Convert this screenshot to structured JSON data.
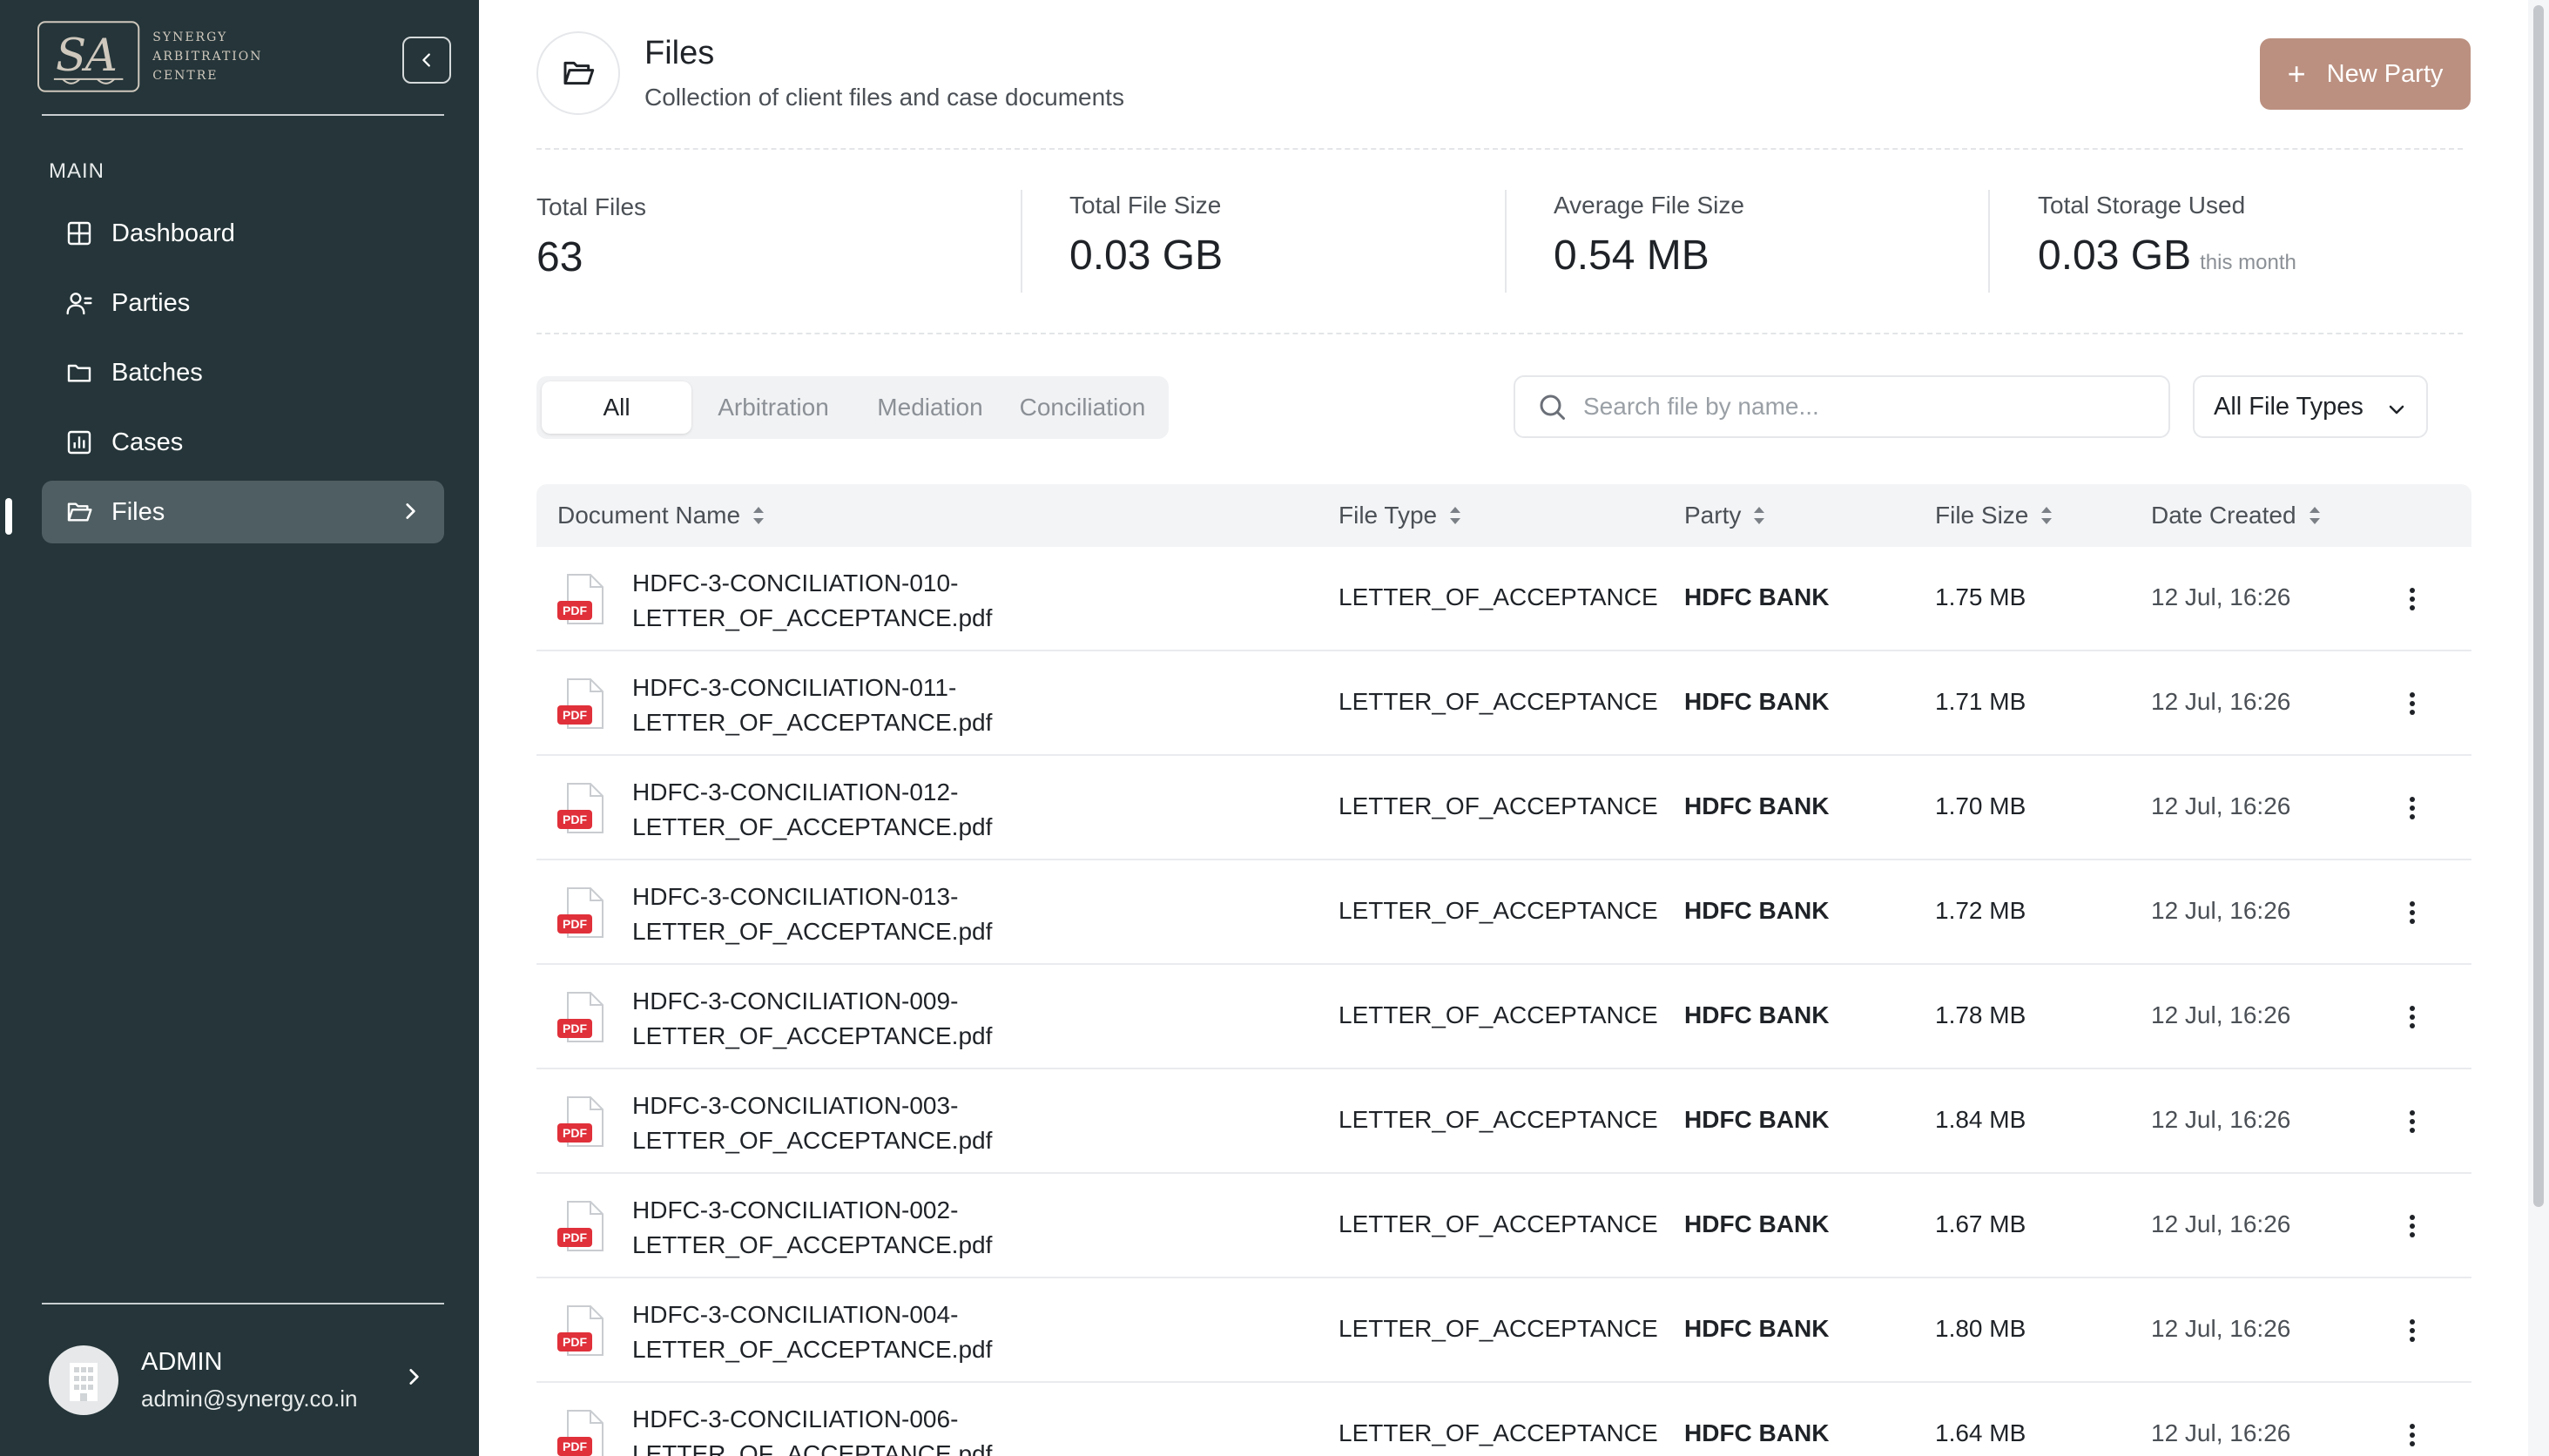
{
  "sidebar": {
    "brand": {
      "line1": "SYNERGY",
      "line2": "ARBITRATION CENTRE"
    },
    "section_label": "MAIN",
    "items": [
      {
        "label": "Dashboard",
        "icon": "grid-icon"
      },
      {
        "label": "Parties",
        "icon": "users-icon"
      },
      {
        "label": "Batches",
        "icon": "folder-icon"
      },
      {
        "label": "Cases",
        "icon": "chart-icon"
      },
      {
        "label": "Files",
        "icon": "folder-open-icon",
        "active": true
      }
    ],
    "user": {
      "name": "ADMIN",
      "email": "admin@synergy.co.in"
    }
  },
  "header": {
    "title": "Files",
    "subtitle": "Collection of client files and case documents",
    "new_button": "New Party"
  },
  "stats": [
    {
      "label": "Total Files",
      "value": "63",
      "suffix": ""
    },
    {
      "label": "Total File Size",
      "value": "0.03 GB",
      "suffix": ""
    },
    {
      "label": "Average File Size",
      "value": "0.54 MB",
      "suffix": ""
    },
    {
      "label": "Total Storage Used",
      "value": "0.03 GB",
      "suffix": "this month"
    }
  ],
  "tabs": [
    {
      "label": "All",
      "active": true
    },
    {
      "label": "Arbitration"
    },
    {
      "label": "Mediation"
    },
    {
      "label": "Conciliation"
    }
  ],
  "search": {
    "placeholder": "Search file by name..."
  },
  "filter": {
    "label": "All File Types"
  },
  "table": {
    "columns": [
      "Document Name",
      "File Type",
      "Party",
      "File Size",
      "Date Created"
    ],
    "rows": [
      {
        "name1": "HDFC-3-CONCILIATION-010-",
        "name2": "LETTER_OF_ACCEPTANCE.pdf",
        "type": "LETTER_OF_ACCEPTANCE",
        "party": "HDFC BANK",
        "size": "1.75 MB",
        "date": "12 Jul, 16:26"
      },
      {
        "name1": "HDFC-3-CONCILIATION-011-",
        "name2": "LETTER_OF_ACCEPTANCE.pdf",
        "type": "LETTER_OF_ACCEPTANCE",
        "party": "HDFC BANK",
        "size": "1.71 MB",
        "date": "12 Jul, 16:26"
      },
      {
        "name1": "HDFC-3-CONCILIATION-012-",
        "name2": "LETTER_OF_ACCEPTANCE.pdf",
        "type": "LETTER_OF_ACCEPTANCE",
        "party": "HDFC BANK",
        "size": "1.70 MB",
        "date": "12 Jul, 16:26"
      },
      {
        "name1": "HDFC-3-CONCILIATION-013-",
        "name2": "LETTER_OF_ACCEPTANCE.pdf",
        "type": "LETTER_OF_ACCEPTANCE",
        "party": "HDFC BANK",
        "size": "1.72 MB",
        "date": "12 Jul, 16:26"
      },
      {
        "name1": "HDFC-3-CONCILIATION-009-",
        "name2": "LETTER_OF_ACCEPTANCE.pdf",
        "type": "LETTER_OF_ACCEPTANCE",
        "party": "HDFC BANK",
        "size": "1.78 MB",
        "date": "12 Jul, 16:26"
      },
      {
        "name1": "HDFC-3-CONCILIATION-003-",
        "name2": "LETTER_OF_ACCEPTANCE.pdf",
        "type": "LETTER_OF_ACCEPTANCE",
        "party": "HDFC BANK",
        "size": "1.84 MB",
        "date": "12 Jul, 16:26"
      },
      {
        "name1": "HDFC-3-CONCILIATION-002-",
        "name2": "LETTER_OF_ACCEPTANCE.pdf",
        "type": "LETTER_OF_ACCEPTANCE",
        "party": "HDFC BANK",
        "size": "1.67 MB",
        "date": "12 Jul, 16:26"
      },
      {
        "name1": "HDFC-3-CONCILIATION-004-",
        "name2": "LETTER_OF_ACCEPTANCE.pdf",
        "type": "LETTER_OF_ACCEPTANCE",
        "party": "HDFC BANK",
        "size": "1.80 MB",
        "date": "12 Jul, 16:26"
      },
      {
        "name1": "HDFC-3-CONCILIATION-006-",
        "name2": "LETTER_OF_ACCEPTANCE.pdf",
        "type": "LETTER_OF_ACCEPTANCE",
        "party": "HDFC BANK",
        "size": "1.64 MB",
        "date": "12 Jul, 16:26"
      }
    ],
    "pdf_badge": "PDF"
  },
  "colors": {
    "sidebar_bg": "#253539",
    "active_nav": "#4f5e62",
    "accent": "#bb9080",
    "pdf_red": "#e0303a"
  }
}
